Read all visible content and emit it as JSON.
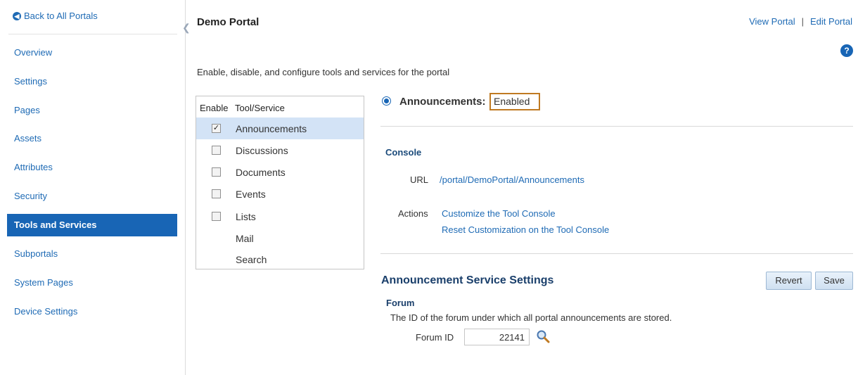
{
  "sidebar": {
    "back_label": "Back to All Portals",
    "items": [
      {
        "label": "Overview"
      },
      {
        "label": "Settings"
      },
      {
        "label": "Pages"
      },
      {
        "label": "Assets"
      },
      {
        "label": "Attributes"
      },
      {
        "label": "Security"
      },
      {
        "label": "Tools and Services",
        "active": true
      },
      {
        "label": "Subportals"
      },
      {
        "label": "System Pages"
      },
      {
        "label": "Device Settings"
      }
    ]
  },
  "header": {
    "title": "Demo Portal",
    "view_portal": "View Portal",
    "separator": "|",
    "edit_portal": "Edit Portal"
  },
  "intro": "Enable, disable, and configure tools and services for the portal",
  "tools": {
    "col_enable": "Enable",
    "col_name": "Tool/Service",
    "rows": [
      {
        "name": "Announcements",
        "checkbox": true,
        "checked": true,
        "selected": true
      },
      {
        "name": "Discussions",
        "checkbox": true,
        "checked": false
      },
      {
        "name": "Documents",
        "checkbox": true,
        "checked": false
      },
      {
        "name": "Events",
        "checkbox": true,
        "checked": false
      },
      {
        "name": "Lists",
        "checkbox": true,
        "checked": false
      },
      {
        "name": "Mail",
        "checkbox": false
      },
      {
        "name": "Search",
        "checkbox": false
      }
    ]
  },
  "detail": {
    "service_label": "Announcements:",
    "status": "Enabled",
    "console_title": "Console",
    "url_label": "URL",
    "url_value": "/portal/DemoPortal/Announcements",
    "actions_label": "Actions",
    "actions": [
      "Customize the Tool Console",
      "Reset Customization on the Tool Console"
    ],
    "settings_title": "Announcement Service Settings",
    "revert_label": "Revert",
    "save_label": "Save",
    "forum_title": "Forum",
    "forum_desc": "The ID of the forum under which all portal announcements are stored.",
    "forum_id_label": "Forum ID",
    "forum_id_value": "22141"
  },
  "colors": {
    "accent": "#1865b5",
    "link": "#1f6bb5",
    "highlight_box": "#c07a22",
    "selected_row": "#d3e3f6"
  },
  "icons": [
    "back-arrow-icon",
    "collapse-chevron-icon",
    "help-icon",
    "search-icon"
  ]
}
